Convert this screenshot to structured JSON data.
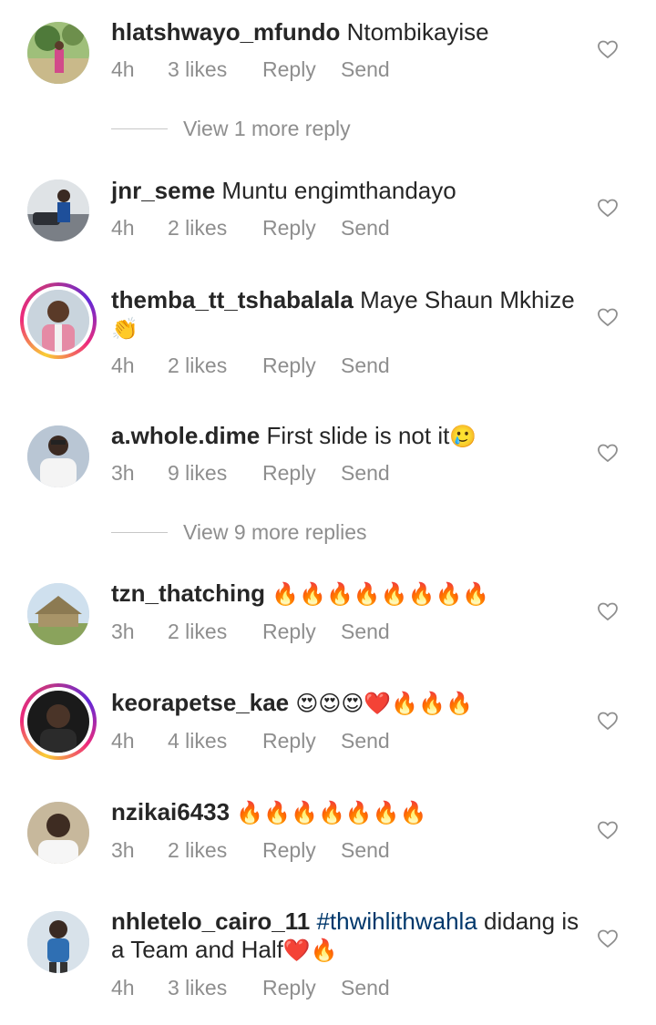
{
  "comments": [
    {
      "username": "hlatshwayo_mfundo",
      "text": "Ntombikayise",
      "time": "4h",
      "likes": "3 likes",
      "reply": "Reply",
      "send": "Send",
      "avatar": "photo-outdoor-woman"
    },
    {
      "username": "jnr_seme",
      "text": "Muntu engimthandayo",
      "time": "4h",
      "likes": "2 likes",
      "reply": "Reply",
      "send": "Send",
      "avatar": "photo-man-car"
    },
    {
      "username": "themba_tt_tshabalala",
      "text": "Maye Shaun Mkhize",
      "emoji2": "👏",
      "time": "4h",
      "likes": "2 likes",
      "reply": "Reply",
      "send": "Send",
      "avatar": "photo-man-pink-shirt"
    },
    {
      "username": "a.whole.dime",
      "text": "First slide is not it",
      "emoji": "🥲",
      "time": "3h",
      "likes": "9 likes",
      "reply": "Reply",
      "send": "Send",
      "avatar": "photo-person-white"
    },
    {
      "username": "tzn_thatching",
      "text": "",
      "emoji": "🔥🔥🔥🔥🔥🔥🔥🔥",
      "time": "3h",
      "likes": "2 likes",
      "reply": "Reply",
      "send": "Send",
      "avatar": "photo-thatched-house"
    },
    {
      "username": "keorapetse_kae",
      "text": "",
      "emoji": "😍😍😍❤️🔥🔥🔥",
      "time": "4h",
      "likes": "4 likes",
      "reply": "Reply",
      "send": "Send",
      "avatar": "photo-dark-portrait"
    },
    {
      "username": "nzikai6433",
      "text": "",
      "emoji": "🔥🔥🔥🔥🔥🔥🔥",
      "time": "3h",
      "likes": "2 likes",
      "reply": "Reply",
      "send": "Send",
      "avatar": "photo-man-white-shirt"
    },
    {
      "username": "nhletelo_cairo_11",
      "hashtag": "#thwihlithwahla",
      "text": " didang is",
      "line2": "a Team and  Half",
      "emoji2": "❤️🔥",
      "time": "4h",
      "likes": "3 likes",
      "reply": "Reply",
      "send": "Send",
      "avatar": "photo-man-standing"
    }
  ],
  "view_more": [
    {
      "label": "View 1 more reply"
    },
    {
      "label": "View 9 more replies"
    }
  ],
  "colors": {
    "username": "#262626",
    "meta": "#8e8e8e",
    "hashtag": "#00376b",
    "heart": "#8e8e8e"
  },
  "icons": {
    "like": "heart-outline-icon"
  }
}
